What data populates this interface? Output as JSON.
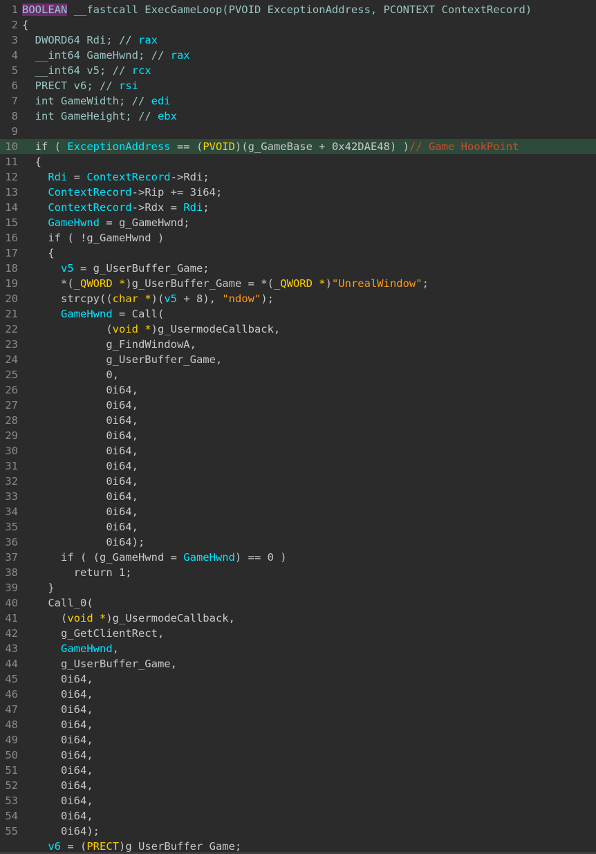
{
  "editor": {
    "lines": [
      {
        "n": "1",
        "toks": [
          [
            "BOOLEAN",
            "type"
          ],
          [
            " __fastcall ExecGameLoop(PVOID ExceptionAddress, PCONTEXT ContextRecord)",
            "type"
          ]
        ]
      },
      {
        "n": "2",
        "toks": [
          [
            "{",
            "plain"
          ]
        ]
      },
      {
        "n": "3",
        "toks": [
          [
            "  DWORD64 Rdi; // ",
            "type"
          ],
          [
            "rax",
            "lvar"
          ]
        ]
      },
      {
        "n": "4",
        "toks": [
          [
            "  __int64 GameHwnd; // ",
            "type"
          ],
          [
            "rax",
            "lvar"
          ]
        ]
      },
      {
        "n": "5",
        "toks": [
          [
            "  __int64 v5; // ",
            "type"
          ],
          [
            "rcx",
            "lvar"
          ]
        ]
      },
      {
        "n": "6",
        "toks": [
          [
            "  PRECT v6; // ",
            "type"
          ],
          [
            "rsi",
            "lvar"
          ]
        ]
      },
      {
        "n": "7",
        "toks": [
          [
            "  int GameWidth; // ",
            "type"
          ],
          [
            "edi",
            "lvar"
          ]
        ]
      },
      {
        "n": "8",
        "toks": [
          [
            "  int GameHeight; // ",
            "type"
          ],
          [
            "ebx",
            "lvar"
          ]
        ]
      },
      {
        "n": "9",
        "toks": []
      },
      {
        "n": "10",
        "hl": true,
        "toks": [
          [
            "  if ( ",
            "plain"
          ],
          [
            "ExceptionAddress",
            "lvar"
          ],
          [
            " == (",
            "plain"
          ],
          [
            "PVOID",
            "kw"
          ],
          [
            ")(g_GameBase + 0x42DAE48) )",
            "plain"
          ],
          [
            "// Game HookPoint",
            "cmt"
          ]
        ]
      },
      {
        "n": "11",
        "toks": [
          [
            "  {",
            "plain"
          ]
        ]
      },
      {
        "n": "12",
        "toks": [
          [
            "    ",
            "plain"
          ],
          [
            "Rdi",
            "lvar"
          ],
          [
            " = ",
            "plain"
          ],
          [
            "ContextRecord",
            "lvar"
          ],
          [
            "->Rdi;",
            "plain"
          ]
        ]
      },
      {
        "n": "13",
        "toks": [
          [
            "    ",
            "plain"
          ],
          [
            "ContextRecord",
            "lvar"
          ],
          [
            "->Rip += 3i64;",
            "plain"
          ]
        ]
      },
      {
        "n": "14",
        "toks": [
          [
            "    ",
            "plain"
          ],
          [
            "ContextRecord",
            "lvar"
          ],
          [
            "->Rdx = ",
            "plain"
          ],
          [
            "Rdi",
            "lvar"
          ],
          [
            ";",
            "plain"
          ]
        ]
      },
      {
        "n": "15",
        "toks": [
          [
            "    ",
            "plain"
          ],
          [
            "GameHwnd",
            "lvar"
          ],
          [
            " = g_GameHwnd;",
            "plain"
          ]
        ]
      },
      {
        "n": "16",
        "toks": [
          [
            "    if ( !g_GameHwnd )",
            "plain"
          ]
        ]
      },
      {
        "n": "17",
        "toks": [
          [
            "    {",
            "plain"
          ]
        ]
      },
      {
        "n": "18",
        "toks": [
          [
            "      ",
            "plain"
          ],
          [
            "v5",
            "lvar"
          ],
          [
            " = g_UserBuffer_Game;",
            "plain"
          ]
        ]
      },
      {
        "n": "19",
        "toks": [
          [
            "      *(",
            "plain"
          ],
          [
            "_QWORD *",
            "kw"
          ],
          [
            ")g_UserBuffer_Game = *(",
            "plain"
          ],
          [
            "_QWORD *",
            "kw"
          ],
          [
            ")",
            "plain"
          ],
          [
            "\"UnrealWindow\"",
            "str"
          ],
          [
            ";",
            "plain"
          ]
        ]
      },
      {
        "n": "20",
        "toks": [
          [
            "      strcpy((",
            "plain"
          ],
          [
            "char *",
            "kw"
          ],
          [
            ")(",
            "plain"
          ],
          [
            "v5",
            "lvar"
          ],
          [
            " + 8), ",
            "plain"
          ],
          [
            "\"ndow\"",
            "str"
          ],
          [
            ");",
            "plain"
          ]
        ]
      },
      {
        "n": "21",
        "toks": [
          [
            "      ",
            "plain"
          ],
          [
            "GameHwnd",
            "lvar"
          ],
          [
            " = Call(",
            "plain"
          ]
        ]
      },
      {
        "n": "22",
        "toks": [
          [
            "             (",
            "plain"
          ],
          [
            "void *",
            "kw"
          ],
          [
            ")g_UsermodeCallback,",
            "plain"
          ]
        ]
      },
      {
        "n": "23",
        "toks": [
          [
            "             g_FindWindowA,",
            "plain"
          ]
        ]
      },
      {
        "n": "24",
        "toks": [
          [
            "             g_UserBuffer_Game,",
            "plain"
          ]
        ]
      },
      {
        "n": "25",
        "toks": [
          [
            "             0,",
            "plain"
          ]
        ]
      },
      {
        "n": "26",
        "toks": [
          [
            "             0i64,",
            "plain"
          ]
        ]
      },
      {
        "n": "27",
        "toks": [
          [
            "             0i64,",
            "plain"
          ]
        ]
      },
      {
        "n": "28",
        "toks": [
          [
            "             0i64,",
            "plain"
          ]
        ]
      },
      {
        "n": "29",
        "toks": [
          [
            "             0i64,",
            "plain"
          ]
        ]
      },
      {
        "n": "30",
        "toks": [
          [
            "             0i64,",
            "plain"
          ]
        ]
      },
      {
        "n": "31",
        "toks": [
          [
            "             0i64,",
            "plain"
          ]
        ]
      },
      {
        "n": "32",
        "toks": [
          [
            "             0i64,",
            "plain"
          ]
        ]
      },
      {
        "n": "33",
        "toks": [
          [
            "             0i64,",
            "plain"
          ]
        ]
      },
      {
        "n": "34",
        "toks": [
          [
            "             0i64,",
            "plain"
          ]
        ]
      },
      {
        "n": "35",
        "toks": [
          [
            "             0i64,",
            "plain"
          ]
        ]
      },
      {
        "n": "36",
        "toks": [
          [
            "             0i64);",
            "plain"
          ]
        ]
      },
      {
        "n": "37",
        "toks": [
          [
            "      if ( (g_GameHwnd = ",
            "plain"
          ],
          [
            "GameHwnd",
            "lvar"
          ],
          [
            ") == 0 )",
            "plain"
          ]
        ]
      },
      {
        "n": "38",
        "toks": [
          [
            "        return 1;",
            "plain"
          ]
        ]
      },
      {
        "n": "39",
        "toks": [
          [
            "    }",
            "plain"
          ]
        ]
      },
      {
        "n": "40",
        "toks": [
          [
            "    Call_0(",
            "plain"
          ]
        ]
      },
      {
        "n": "41",
        "toks": [
          [
            "      (",
            "plain"
          ],
          [
            "void *",
            "kw"
          ],
          [
            ")g_UsermodeCallback,",
            "plain"
          ]
        ]
      },
      {
        "n": "42",
        "toks": [
          [
            "      g_GetClientRect,",
            "plain"
          ]
        ]
      },
      {
        "n": "43",
        "toks": [
          [
            "      ",
            "plain"
          ],
          [
            "GameHwnd",
            "lvar"
          ],
          [
            ",",
            "plain"
          ]
        ]
      },
      {
        "n": "44",
        "toks": [
          [
            "      g_UserBuffer_Game,",
            "plain"
          ]
        ]
      },
      {
        "n": "45",
        "toks": [
          [
            "      0i64,",
            "plain"
          ]
        ]
      },
      {
        "n": "46",
        "toks": [
          [
            "      0i64,",
            "plain"
          ]
        ]
      },
      {
        "n": "47",
        "toks": [
          [
            "      0i64,",
            "plain"
          ]
        ]
      },
      {
        "n": "48",
        "toks": [
          [
            "      0i64,",
            "plain"
          ]
        ]
      },
      {
        "n": "49",
        "toks": [
          [
            "      0i64,",
            "plain"
          ]
        ]
      },
      {
        "n": "50",
        "toks": [
          [
            "      0i64,",
            "plain"
          ]
        ]
      },
      {
        "n": "51",
        "toks": [
          [
            "      0i64,",
            "plain"
          ]
        ]
      },
      {
        "n": "52",
        "toks": [
          [
            "      0i64,",
            "plain"
          ]
        ]
      },
      {
        "n": "53",
        "toks": [
          [
            "      0i64,",
            "plain"
          ]
        ]
      },
      {
        "n": "54",
        "toks": [
          [
            "      0i64,",
            "plain"
          ]
        ]
      },
      {
        "n": "55",
        "toks": [
          [
            "      0i64);",
            "plain"
          ]
        ]
      },
      {
        "n": "",
        "toks": [
          [
            "    ",
            "plain"
          ],
          [
            "v6",
            "lvar"
          ],
          [
            " = (",
            "plain"
          ],
          [
            "PRECT",
            "kw"
          ],
          [
            ")g_UserBuffer_Game;",
            "plain"
          ]
        ]
      }
    ]
  },
  "colors": {
    "background": "#2b2b2b",
    "highlight_line": "#2e4a3b",
    "line_number": "#8a8a8a",
    "plain": "#c8c8c8",
    "type": "#99c5c3",
    "local_var": "#00e5ff",
    "keyword_type": "#ffd000",
    "string": "#ff9a1c",
    "comment": "#d04a2a"
  }
}
